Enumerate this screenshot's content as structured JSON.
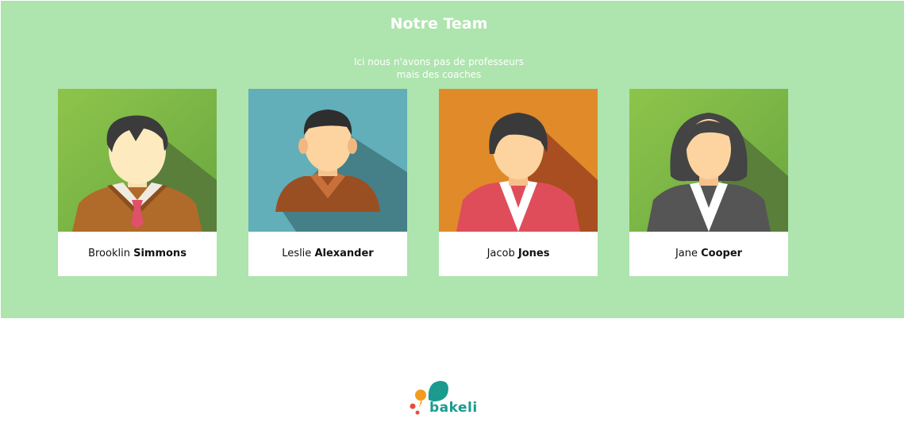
{
  "team": {
    "title": "Notre Team",
    "subtitle_line1": "Ici nous n'avons pas de professeurs",
    "subtitle_line2": "mais des coaches",
    "background_color": "#aee4ae"
  },
  "members": [
    {
      "first_name": "Brooklin",
      "last_name": "Simmons",
      "avatar": "man-sweater-avatar",
      "bg_color": "#8bc34a"
    },
    {
      "first_name": "Leslie",
      "last_name": "Alexander",
      "avatar": "man-brown-shirt-avatar",
      "bg_color": "#62aeb9"
    },
    {
      "first_name": "Jacob",
      "last_name": "Jones",
      "avatar": "woman-red-jacket-avatar",
      "bg_color": "#e08a2a"
    },
    {
      "first_name": "Jane",
      "last_name": "Cooper",
      "avatar": "woman-grey-jacket-avatar",
      "bg_color": "#8bc34a"
    }
  ],
  "footer": {
    "logo_text": "bakeli",
    "logo_color": "#1a9b8e"
  }
}
